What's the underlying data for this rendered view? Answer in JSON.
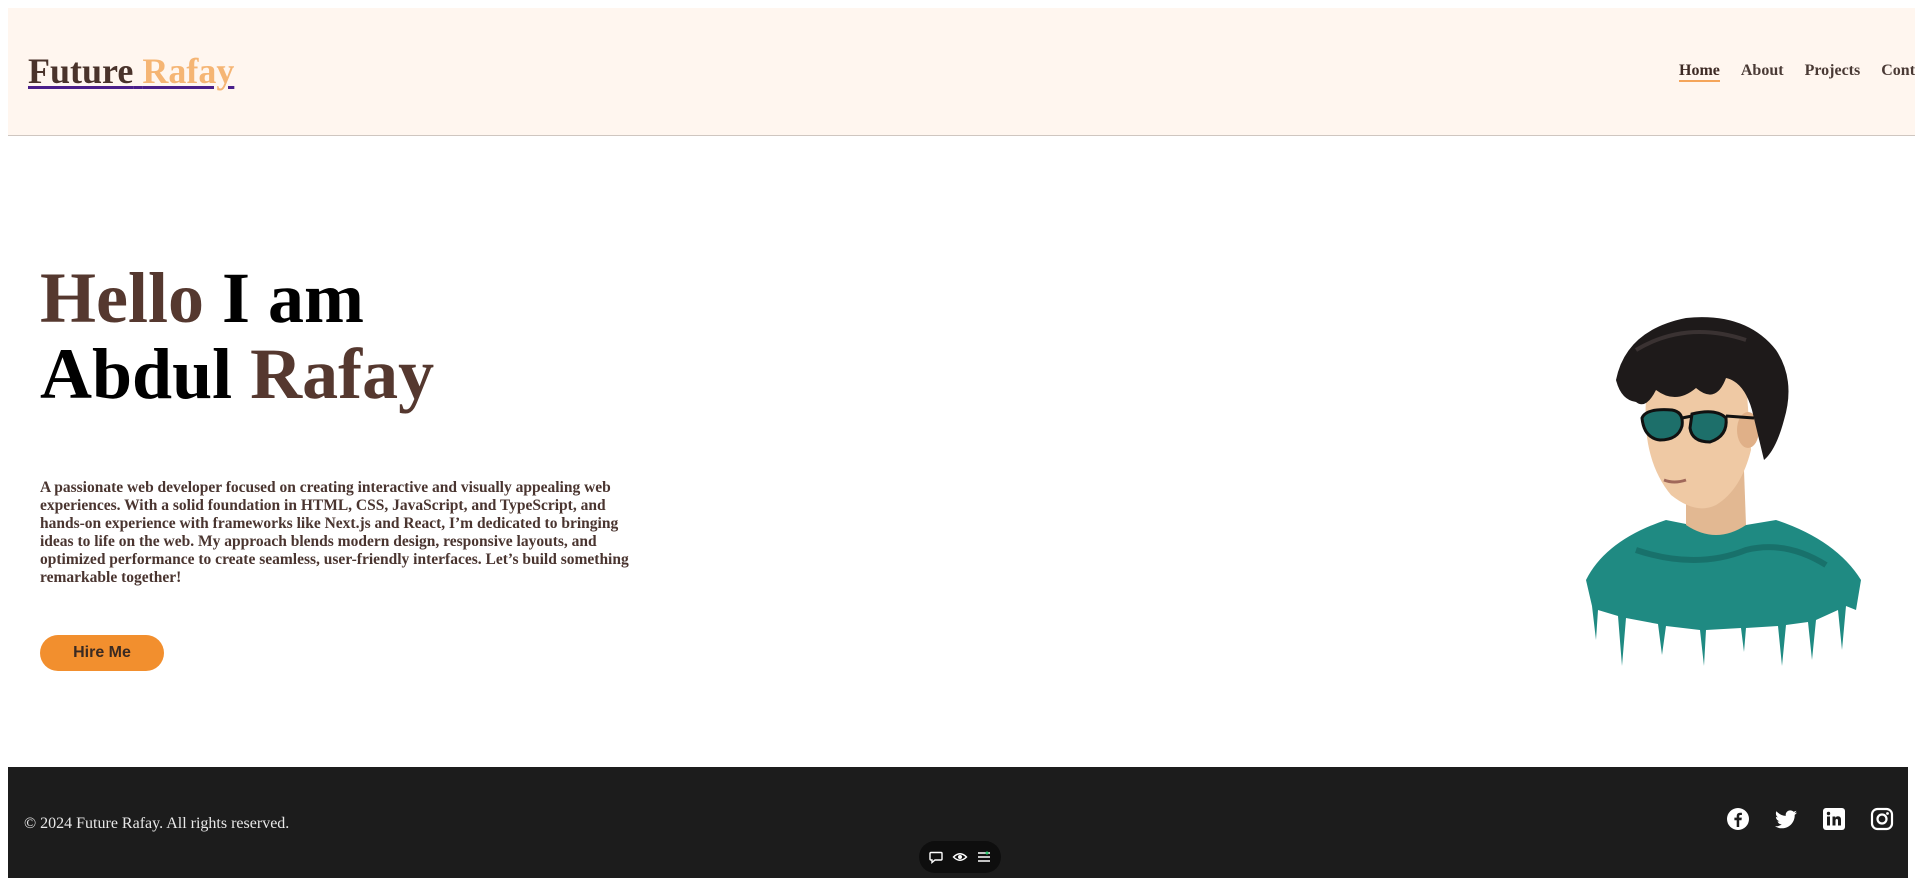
{
  "header": {
    "logo_main": "Future",
    "logo_accent": "Rafay",
    "nav": [
      "Home",
      "About",
      "Projects",
      "Contact"
    ]
  },
  "hero": {
    "title_hello": "Hello",
    "title_iam": "I am",
    "title_first": "Abdul",
    "title_last": "Rafay",
    "description": "A passionate web developer focused on creating interactive and visually appealing web experiences. With a solid foundation in HTML, CSS, JavaScript, and TypeScript, and hands-on experience with frameworks like Next.js and React, I’m dedicated to bringing ideas to life on the web. My approach blends modern design, responsive layouts, and optimized performance to create seamless, user-friendly interfaces. Let’s build something remarkable together!",
    "hire_label": "Hire Me"
  },
  "footer": {
    "copyright": "© 2024 Future Rafay. All rights reserved.",
    "socials": [
      "facebook-icon",
      "twitter-icon",
      "linkedin-icon",
      "instagram-icon"
    ]
  },
  "toolbar": {
    "icons": [
      "comment-icon",
      "eye-icon",
      "settings-list-icon"
    ]
  },
  "colors": {
    "header_bg": "#fff6ef",
    "accent_orange": "#f28f2e",
    "logo_accent": "#f5b574",
    "brown_text": "#55382f",
    "footer_bg": "#1c1c1c"
  }
}
